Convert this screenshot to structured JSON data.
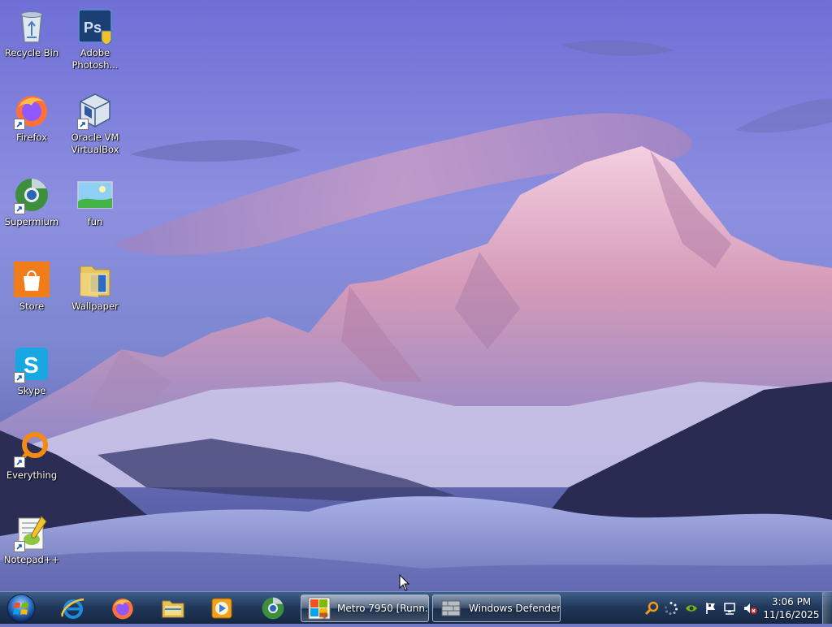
{
  "desktop": {
    "icons": [
      {
        "label": "Recycle Bin",
        "icon": "recycle-bin-icon",
        "shortcut": false
      },
      {
        "label": "Adobe Photosh...",
        "icon": "photoshop-icon",
        "shortcut": false
      },
      {
        "label": "Firefox",
        "icon": "firefox-icon",
        "shortcut": true
      },
      {
        "label": "Oracle VM VirtualBox",
        "icon": "virtualbox-icon",
        "shortcut": true
      },
      {
        "label": "Supermium",
        "icon": "supermium-icon",
        "shortcut": true
      },
      {
        "label": "fun",
        "icon": "image-file-icon",
        "shortcut": false
      },
      {
        "label": "Store",
        "icon": "store-icon",
        "shortcut": false
      },
      {
        "label": "Wallpaper",
        "icon": "folder-icon",
        "shortcut": false
      },
      {
        "label": "Skype",
        "icon": "skype-icon",
        "shortcut": true
      },
      {
        "label": "Everything",
        "icon": "everything-icon",
        "shortcut": true
      },
      {
        "label": "Notepad++",
        "icon": "notepadpp-icon",
        "shortcut": true
      }
    ]
  },
  "taskbar": {
    "start": {
      "icon": "windows-orb-icon"
    },
    "pinned": [
      {
        "icon": "internet-explorer-icon"
      },
      {
        "icon": "firefox-icon"
      },
      {
        "icon": "file-explorer-icon"
      },
      {
        "icon": "media-player-icon"
      },
      {
        "icon": "supermium-icon"
      }
    ],
    "tasks": [
      {
        "label": "Metro 7950 [Runn...",
        "icon": "xp-vm-icon",
        "active": true
      },
      {
        "label": "Windows Defender",
        "icon": "windows-defender-icon",
        "active": false
      }
    ],
    "tray": [
      {
        "icon": "search-icon"
      },
      {
        "icon": "loading-spinner-icon"
      },
      {
        "icon": "nvidia-icon"
      },
      {
        "icon": "action-center-flag-icon"
      },
      {
        "icon": "network-icon"
      },
      {
        "icon": "volume-muted-icon"
      }
    ],
    "clock": {
      "time": "3:06 PM",
      "date": "11/16/2025"
    }
  },
  "colors": {
    "sky": "#7f86d8",
    "taskbar": "#22395c",
    "label_text": "#ffffff"
  }
}
